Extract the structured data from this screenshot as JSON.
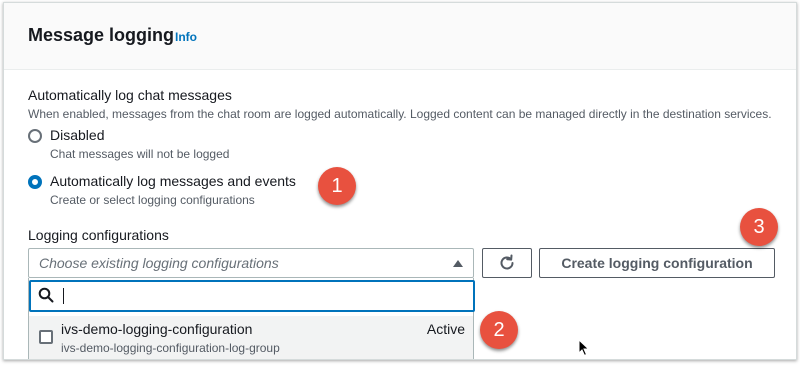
{
  "header": {
    "title": "Message logging",
    "info_link": "Info"
  },
  "auto_log": {
    "label": "Automatically log chat messages",
    "description": "When enabled, messages from the chat room are logged automatically. Logged content can be managed directly in the destination services.",
    "options": [
      {
        "label": "Disabled",
        "description": "Chat messages will not be logged",
        "selected": false
      },
      {
        "label": "Automatically log messages and events",
        "description": "Create or select logging configurations",
        "selected": true
      }
    ]
  },
  "logging_configs": {
    "label": "Logging configurations",
    "select_placeholder": "Choose existing logging configurations",
    "create_button": "Create logging configuration",
    "search_placeholder": "",
    "items": [
      {
        "name": "ivs-demo-logging-configuration",
        "log_group": "ivs-demo-logging-configuration-log-group",
        "status": "Active",
        "checked": false
      }
    ]
  },
  "callouts": [
    "1",
    "2",
    "3"
  ],
  "colors": {
    "accent": "#0073bb",
    "callout": "#e8513f",
    "text": "#16191f",
    "muted": "#545b64"
  },
  "icons": [
    "search-icon",
    "refresh-icon",
    "caret-up-icon",
    "mouse-cursor-icon"
  ]
}
